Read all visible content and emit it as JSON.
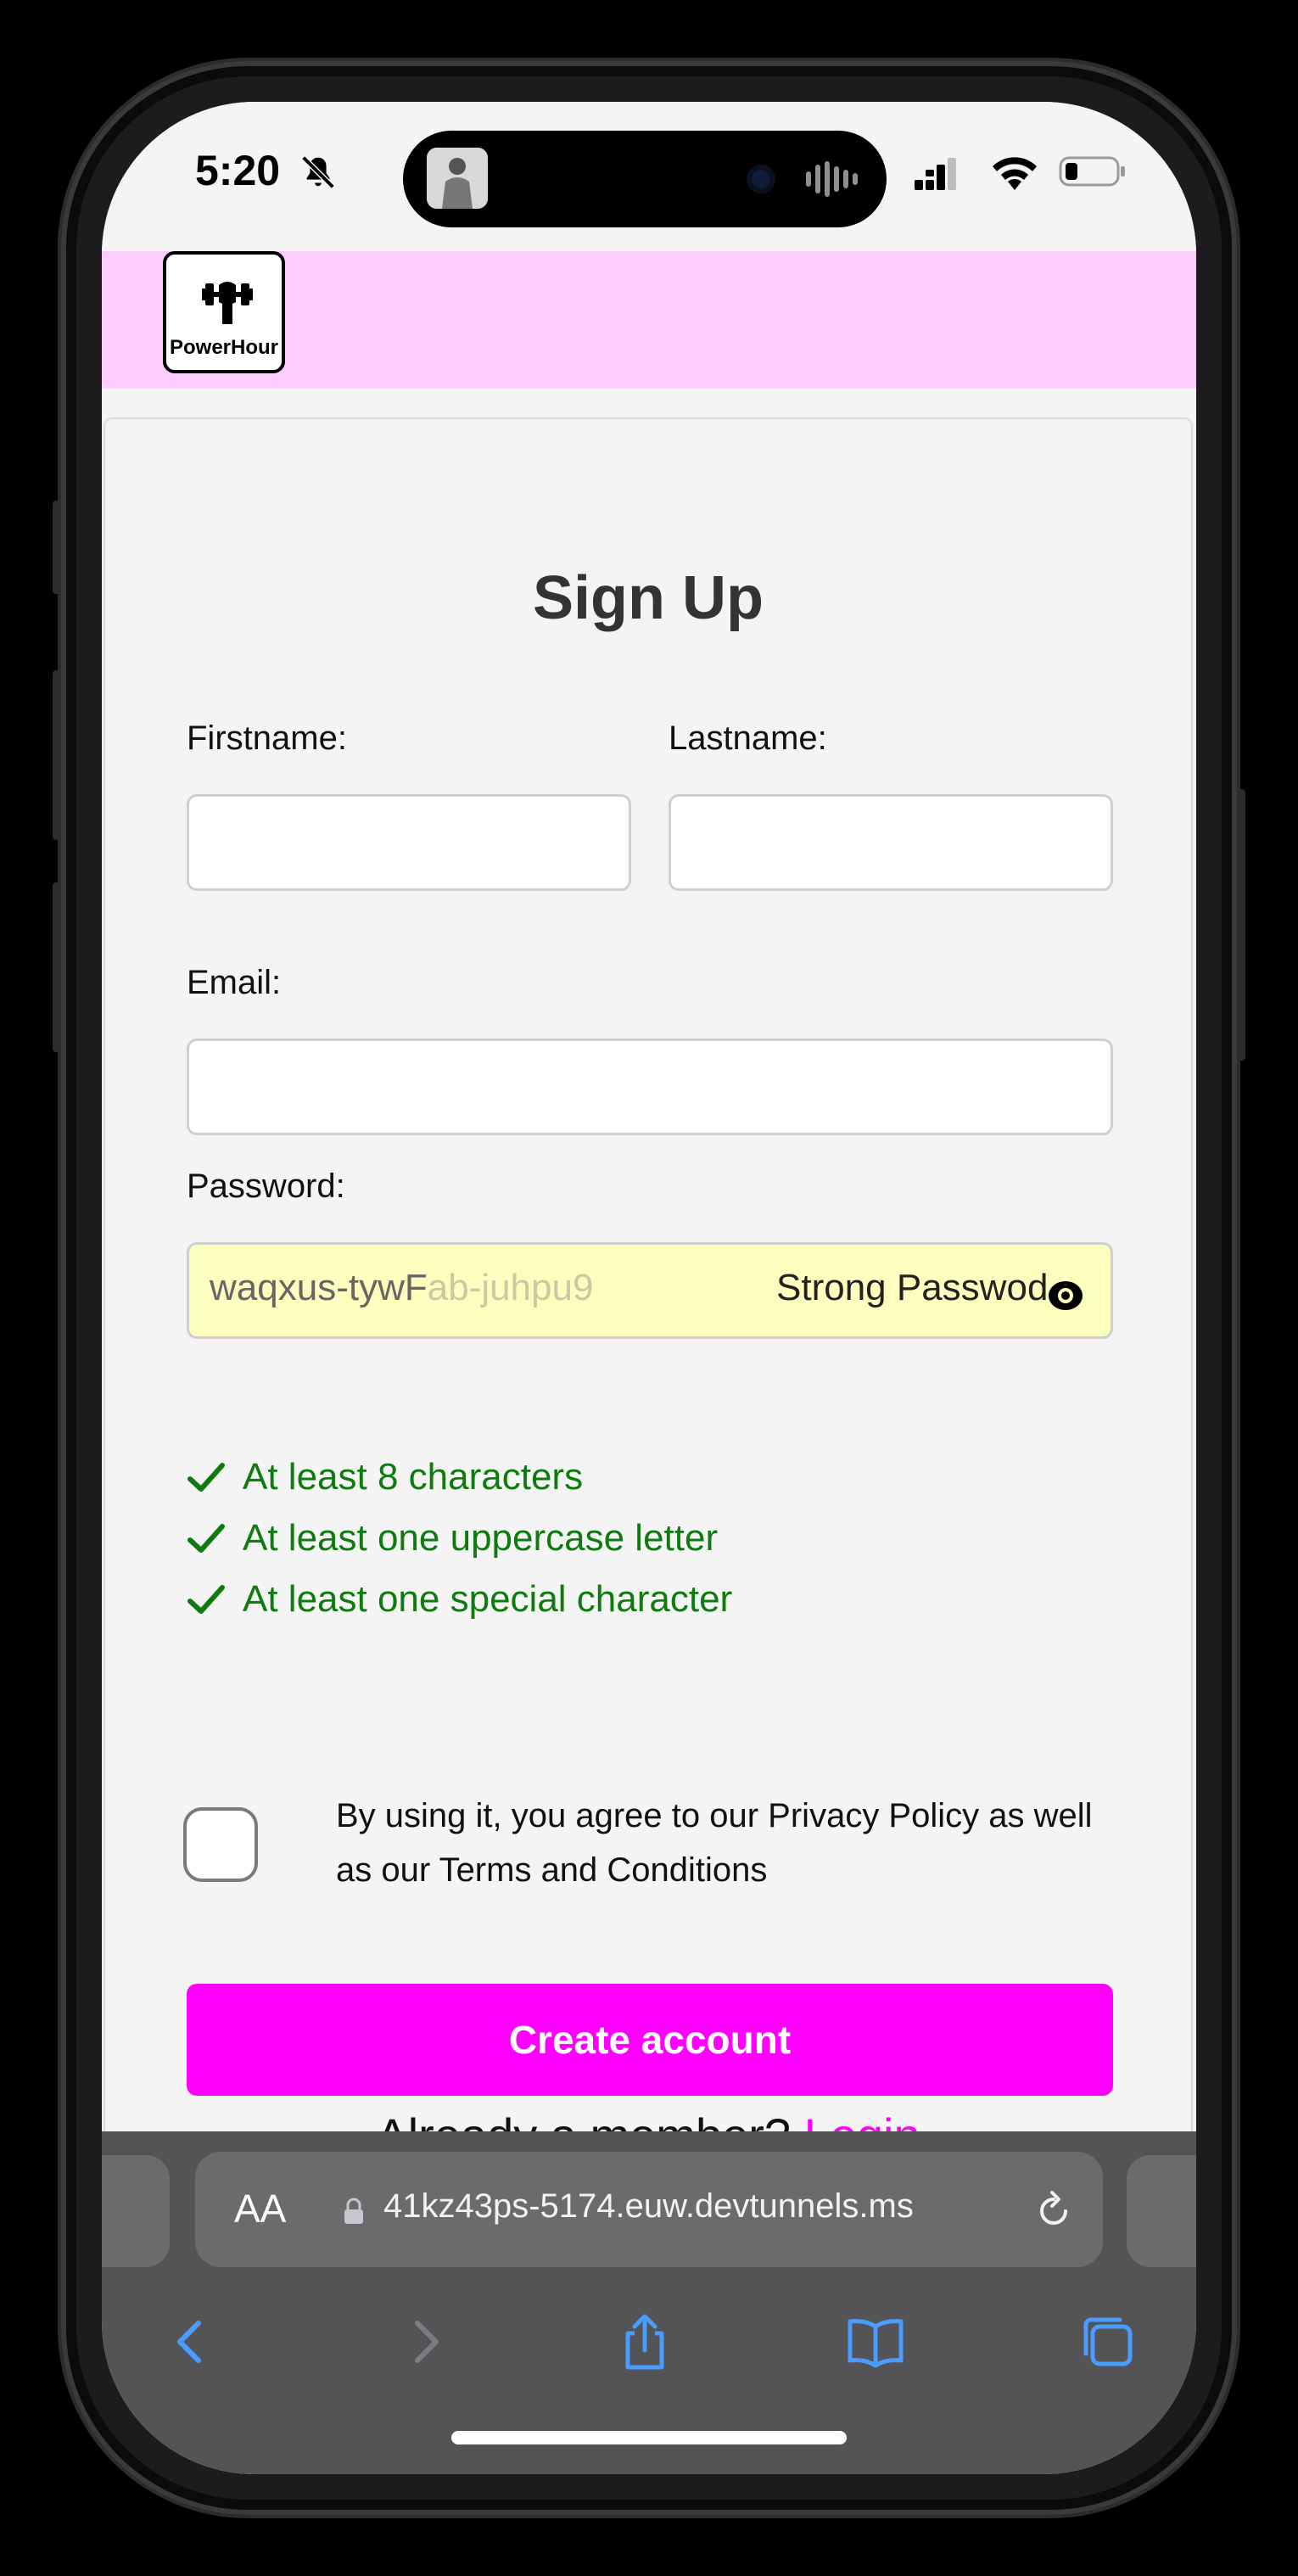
{
  "status": {
    "time": "5:20"
  },
  "brand": {
    "name": "PowerHour"
  },
  "form": {
    "title": "Sign Up",
    "firstname_label": "Firstname:",
    "lastname_label": "Lastname:",
    "email_label": "Email:",
    "password_label": "Password:",
    "password_value_visible": "waqxus-tywF",
    "password_value_faded": "ab-juhpu9",
    "password_autofill_text": "Strong Passwo",
    "password_autofill_tail": "d",
    "rules": [
      "At least 8 characters",
      "At least one uppercase letter",
      "At least one special character"
    ],
    "rule_color": "#0f7b0f",
    "terms_text": "By using it, you agree to our Privacy Policy as well as our Terms and Conditions",
    "terms_checked": false,
    "submit_label": "Create account",
    "member_text": "Already a member?",
    "login_label": "Login",
    "accent_color": "#ff00ff",
    "header_color": "#fecbff"
  },
  "browser": {
    "aa_label": "AA",
    "url": "41kz43ps-5174.euw.devtunnels.ms"
  }
}
